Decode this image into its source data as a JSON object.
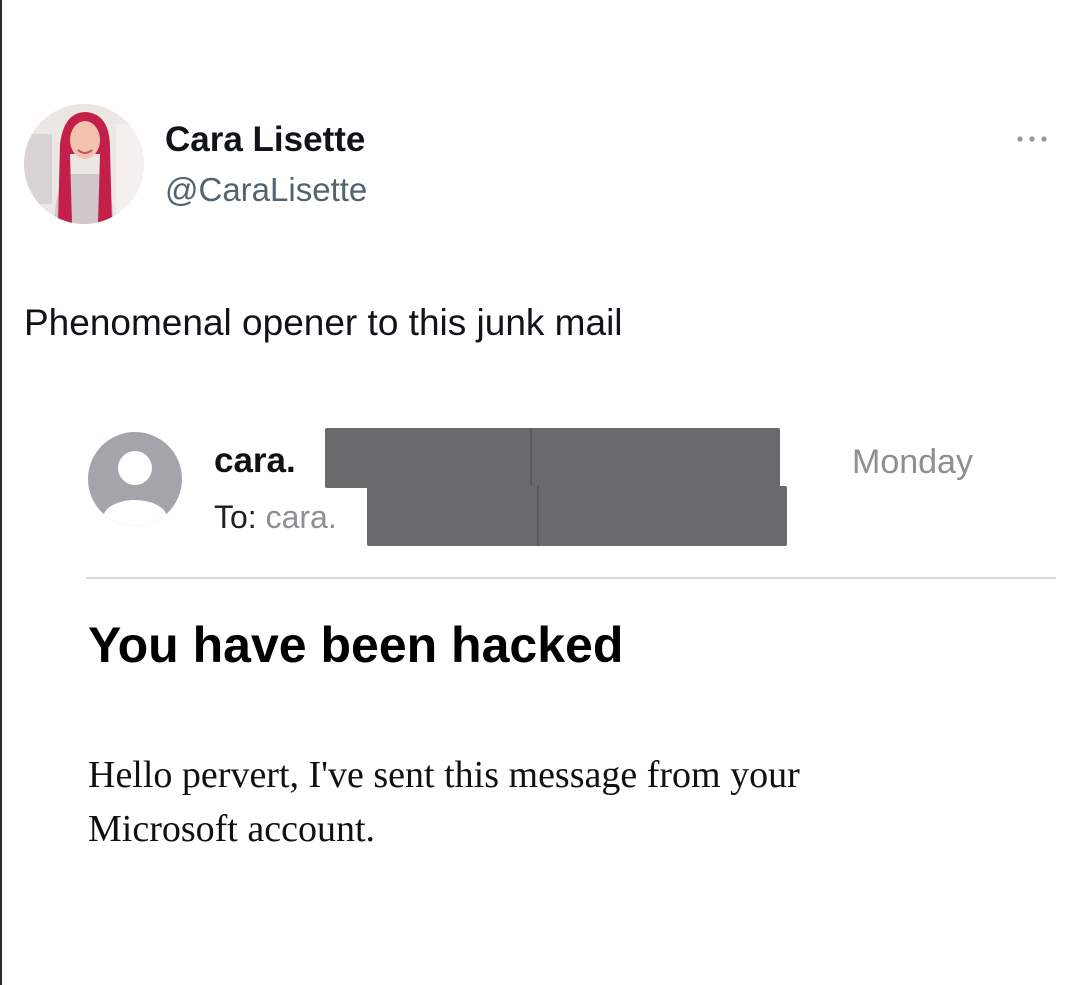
{
  "tweet": {
    "author": {
      "display_name": "Cara Lisette",
      "handle": "@CaraLisette",
      "avatar_icon": "profile-photo"
    },
    "more_icon": "more-horizontal-icon",
    "text": "Phenomenal opener to this junk mail"
  },
  "email": {
    "sender_icon": "person-icon",
    "sender": "cara.",
    "to_label": "To:",
    "to_value": "cara.",
    "date": "Monday",
    "subject": "You have been hacked",
    "body_line1": "Hello pervert, I've sent this message from your",
    "body_line2": "Microsoft account."
  },
  "colors": {
    "redaction": "#6a6a6c",
    "muted_text": "#8e8e93",
    "handle_text": "#536471"
  }
}
